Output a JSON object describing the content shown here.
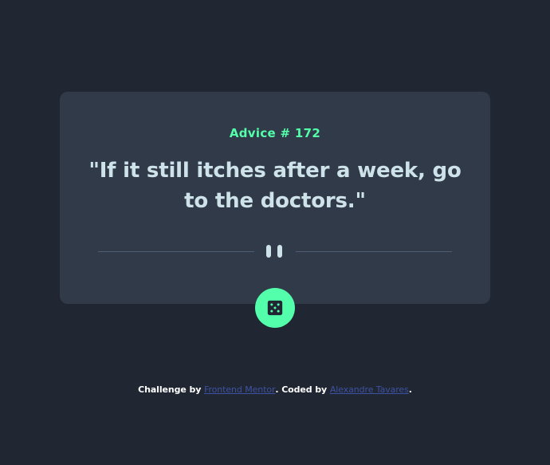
{
  "advice": {
    "id_label": "Advice # 172",
    "quote": "\"If it still itches after a week, go to the doctors.\""
  },
  "divider": {
    "icon": "pause-icon"
  },
  "dice_button": {
    "icon": "dice-icon"
  },
  "attribution": {
    "prefix": "Challenge by ",
    "link1": "Frontend Mentor",
    "middle": ". Coded by ",
    "link2": "Alexandre Tavares",
    "suffix": "."
  },
  "colors": {
    "background": "#202632",
    "card": "#313a49",
    "accent": "#53ffaa",
    "quote_text": "#cee3e9",
    "divider": "#4f5d74",
    "link": "#3e52a3"
  }
}
